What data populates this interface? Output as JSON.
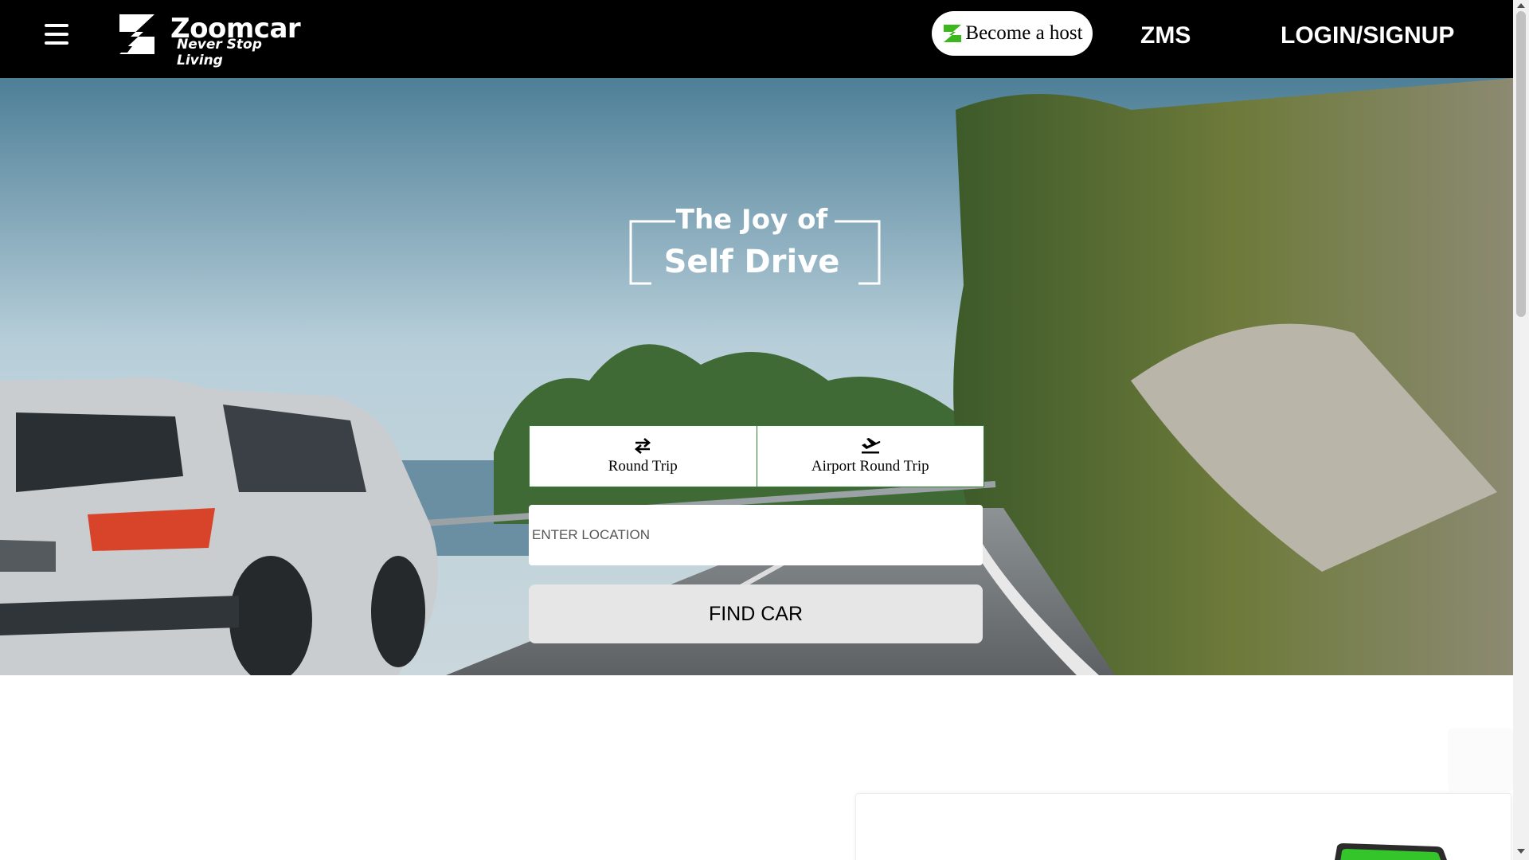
{
  "header": {
    "brand_name": "Zoomcar",
    "brand_tagline": "Never Stop Living",
    "host_button_label": "Become a host",
    "zms_label": "ZMS",
    "login_label": "LOGIN/SIGNUP"
  },
  "hero": {
    "tagline_line1": "The Joy of",
    "tagline_line2": "Self Drive",
    "trip_tabs": [
      {
        "label": "Round Trip",
        "icon": "swap-arrows-icon"
      },
      {
        "label": "Airport Round Trip",
        "icon": "airplane-icon"
      }
    ],
    "location_placeholder": "ENTER LOCATION",
    "find_button_label": "FIND CAR"
  },
  "colors": {
    "header_bg": "#000000",
    "accent_green": "#3cb81e",
    "tab_border": "#2e7d32",
    "button_bg": "#e6e6e6"
  }
}
